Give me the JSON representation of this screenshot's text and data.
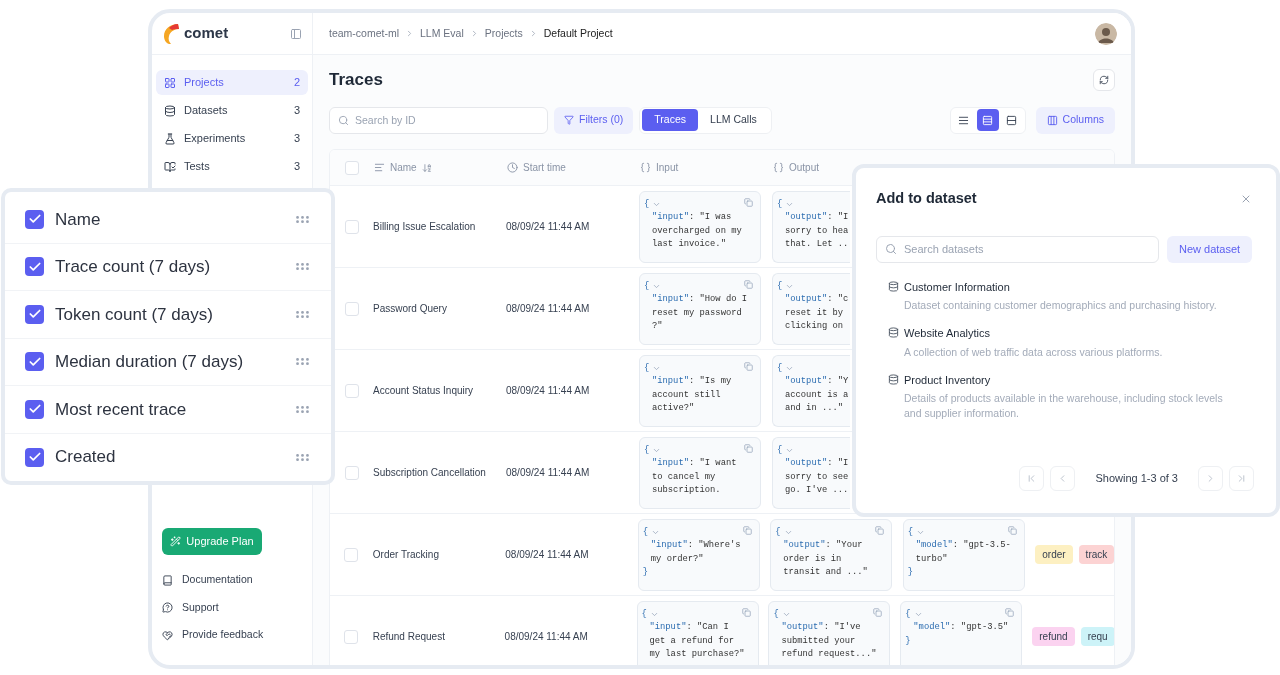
{
  "app": {
    "logo_text": "comet"
  },
  "breadcrumb": [
    "team-comet-ml",
    "LLM Eval",
    "Projects",
    "Default Project"
  ],
  "sidebar": {
    "items": [
      {
        "label": "Projects",
        "count": "2",
        "selected": true,
        "kind": "projects"
      },
      {
        "label": "Datasets",
        "count": "3",
        "selected": false,
        "kind": "datasets"
      },
      {
        "label": "Experiments",
        "count": "3",
        "selected": false,
        "kind": "experiments"
      },
      {
        "label": "Tests",
        "count": "3",
        "selected": false,
        "kind": "tests"
      }
    ],
    "upgrade_button": "Upgrade Plan",
    "links": [
      {
        "label": "Documentation",
        "kind": "docs"
      },
      {
        "label": "Support",
        "kind": "support"
      },
      {
        "label": "Provide feedback",
        "kind": "feedback"
      }
    ]
  },
  "page": {
    "title": "Traces"
  },
  "toolbar": {
    "search": {
      "placeholder": "Search by ID"
    },
    "filters_button": "Filters (0)",
    "view_tabs": [
      {
        "label": "Traces",
        "selected": true
      },
      {
        "label": "LLM Calls",
        "selected": false
      }
    ],
    "row_heights": [
      {
        "kind": "small",
        "selected": false
      },
      {
        "kind": "medium",
        "selected": true
      },
      {
        "kind": "large",
        "selected": false
      }
    ],
    "columns_button": "Columns"
  },
  "table": {
    "select_all_checked": false,
    "columns": [
      {
        "label": "Name",
        "kind": "name"
      },
      {
        "label": "Start time",
        "kind": "time"
      },
      {
        "label": "Input",
        "kind": "json"
      },
      {
        "label": "Output",
        "kind": "json"
      }
    ],
    "rows": [
      {
        "checked": false,
        "name": "Billing Issue Escalation",
        "start_time": "08/09/24 11:44 AM",
        "input": {
          "open": "{",
          "key": "\"input\"",
          "lines": [
            ": \"I was",
            "overcharged on my",
            "last invoice.\""
          ]
        },
        "output": {
          "open": "{",
          "key": "\"output\"",
          "lines": [
            ": \"I",
            "sorry to hea",
            "that. Let .."
          ],
          "covered": true
        }
      },
      {
        "checked": false,
        "name": "Password Query",
        "start_time": "08/09/24 11:44 AM",
        "input": {
          "open": "{",
          "key": "\"input\"",
          "lines": [
            ": \"How do I",
            "reset my password",
            "?\""
          ]
        },
        "output": {
          "open": "{",
          "key": "\"output\"",
          "lines": [
            ": \"c",
            "reset it by",
            "clicking on"
          ],
          "covered": true
        }
      },
      {
        "checked": false,
        "name": "Account Status Inquiry",
        "start_time": "08/09/24 11:44 AM",
        "input": {
          "open": "{",
          "key": "\"input\"",
          "lines": [
            ": \"Is my",
            "account still",
            "active?\""
          ]
        },
        "output": {
          "open": "{",
          "key": "\"output\"",
          "lines": [
            ": \"Y",
            "account is a",
            "and in ...\""
          ],
          "covered": true
        }
      },
      {
        "checked": false,
        "name": "Subscription Cancellation",
        "start_time": "08/09/24 11:44 AM",
        "input": {
          "open": "{",
          "key": "\"input\"",
          "lines": [
            ": \"I want",
            "to cancel my",
            "subscription."
          ]
        },
        "output": {
          "open": "{",
          "key": "\"output\"",
          "lines": [
            ": \"I",
            "sorry to see",
            "go. I've ..."
          ],
          "covered": true
        }
      },
      {
        "checked": false,
        "name": "Order Tracking",
        "start_time": "08/09/24 11:44 AM",
        "input": {
          "open": "{",
          "key": "\"input\"",
          "lines": [
            ": \"Where's",
            "my order?\""
          ],
          "close": "}"
        },
        "output": {
          "open": "{",
          "key": "\"output\"",
          "lines": [
            ": \"Your",
            "order is in",
            "transit and ...\""
          ]
        },
        "metadata": {
          "open": "{",
          "key": "\"model\"",
          "lines": [
            ": \"gpt-3.5-",
            "turbo\""
          ],
          "close": "}"
        },
        "tags": [
          {
            "label": "order",
            "color": "#fdf0c2"
          },
          {
            "label": "track",
            "color": "#fcd3d3"
          }
        ]
      },
      {
        "checked": false,
        "name": "Refund Request",
        "start_time": "08/09/24 11:44 AM",
        "input": {
          "open": "{",
          "key": "\"input\"",
          "lines": [
            ": \"Can I",
            "get a refund for",
            "my last purchase?\""
          ]
        },
        "output": {
          "open": "{",
          "key": "\"output\"",
          "lines": [
            ": \"I've",
            "submitted your",
            "refund request...\""
          ]
        },
        "metadata": {
          "open": "{",
          "key": "\"model\"",
          "lines": [
            ": \"gpt-3.5\""
          ],
          "close": "}"
        },
        "tags": [
          {
            "label": "refund",
            "color": "#fbd3f0"
          },
          {
            "label": "requ",
            "color": "#cdf3f8"
          }
        ]
      }
    ]
  },
  "columns_menu": {
    "items": [
      {
        "label": "Name",
        "checked": true
      },
      {
        "label": "Trace count (7 days)",
        "checked": true
      },
      {
        "label": "Token count (7 days)",
        "checked": true
      },
      {
        "label": "Median duration (7 days)",
        "checked": true
      },
      {
        "label": "Most recent trace",
        "checked": true
      },
      {
        "label": "Created",
        "checked": true
      }
    ]
  },
  "dialog": {
    "title": "Add to dataset",
    "search": {
      "placeholder": "Search datasets"
    },
    "new_button": "New dataset",
    "datasets": [
      {
        "name": "Customer Information",
        "description": "Dataset containing customer demographics and purchasing history."
      },
      {
        "name": "Website Analytics",
        "description": "A collection of web traffic data across various platforms."
      },
      {
        "name": "Product Inventory",
        "description": "Details of products available in the warehouse, including stock levels and supplier information."
      }
    ],
    "pagination": {
      "summary": "Showing 1-3 of 3",
      "buttons": [
        {
          "kind": "first",
          "disabled": true
        },
        {
          "kind": "prev",
          "disabled": true
        },
        {
          "kind": "next",
          "disabled": true
        },
        {
          "kind": "last",
          "disabled": true
        }
      ]
    }
  }
}
